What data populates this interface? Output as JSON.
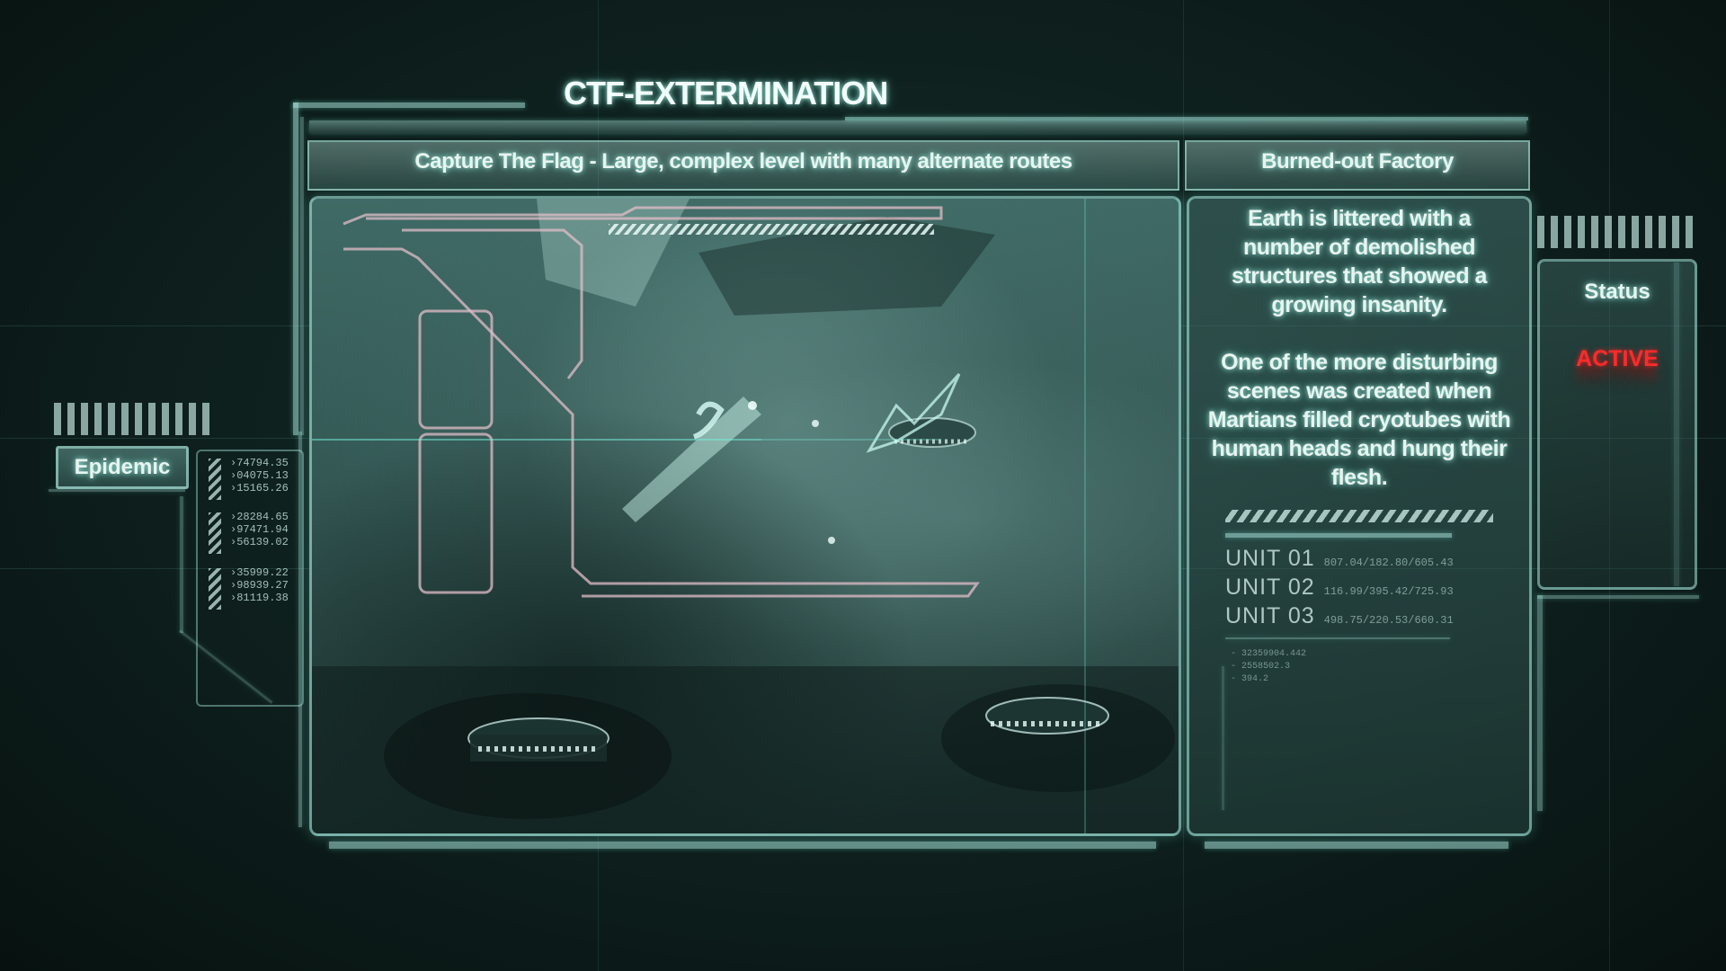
{
  "level": {
    "title": "CTF-EXTERMINATION",
    "mode_description": "Capture The Flag  - Large, complex level with many alternate routes",
    "subtitle": "Burned-out Factory",
    "description_paragraph_1": "Earth is littered with a number of demolished structures that showed a growing insanity.",
    "description_paragraph_2": "One of the more disturbing scenes was created when Martians filled cryotubes with human heads and hung their flesh."
  },
  "units": [
    {
      "label": "UNIT 01",
      "coords": "807.04/182.80/605.43"
    },
    {
      "label": "UNIT 02",
      "coords": "116.99/395.42/725.93"
    },
    {
      "label": "UNIT 03",
      "coords": "498.75/220.53/660.31"
    }
  ],
  "small_numbers": [
    "- 32359904.442",
    "- 2558502.3",
    "- 394.2"
  ],
  "status": {
    "label": "Status",
    "value": "ACTIVE",
    "value_color": "#ff2a2a"
  },
  "left_panel": {
    "label": "Epidemic",
    "readouts": [
      [
        "›74794.35",
        "›04075.13",
        "›15165.26"
      ],
      [
        "›28284.65",
        "›97471.94",
        "›56139.02"
      ],
      [
        "›35999.22",
        "›98939.27",
        "›81119.38"
      ]
    ]
  },
  "colors": {
    "accent": "#9fe6da",
    "background": "#0f2220",
    "alert": "#ff2a2a"
  }
}
